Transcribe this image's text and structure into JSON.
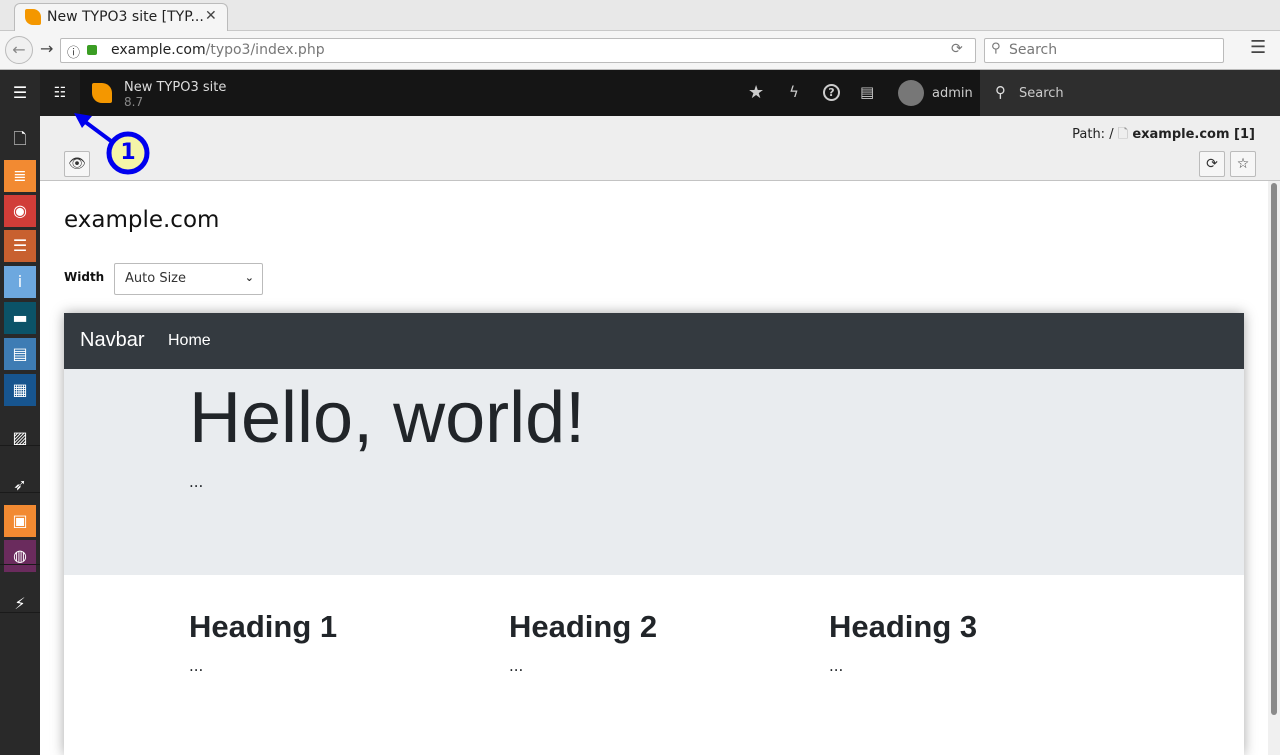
{
  "browser": {
    "tab_title": "New TYPO3 site [TYP...",
    "url_host": "example.com",
    "url_path": "/typo3/index.php",
    "search_placeholder": "Search"
  },
  "topbar": {
    "site_name": "New TYPO3 site",
    "version": "8.7",
    "user": "admin",
    "search_label": "Search"
  },
  "sidebar": {
    "modules": [
      {
        "name": "page",
        "color": "#292929",
        "glyph": "🗋"
      },
      {
        "name": "web-list",
        "color": "#f28a32",
        "glyph": "≣"
      },
      {
        "name": "view",
        "color": "#d13d38",
        "glyph": "◉"
      },
      {
        "name": "list",
        "color": "#c8602f",
        "glyph": "☰"
      },
      {
        "name": "info",
        "color": "#6da8df",
        "glyph": "i"
      },
      {
        "name": "template",
        "color": "#0b5368",
        "glyph": "▬"
      },
      {
        "name": "news",
        "color": "#3e7cb4",
        "glyph": "▤"
      },
      {
        "name": "layout",
        "color": "#17558f",
        "glyph": "▦"
      },
      {
        "name": "filelist",
        "color": "#292929",
        "glyph": "▨"
      },
      {
        "name": "rocket",
        "color": "#292929",
        "glyph": "➶"
      },
      {
        "name": "extension",
        "color": "#f28a32",
        "glyph": "▣"
      },
      {
        "name": "sites",
        "color": "#6a2b5d",
        "glyph": "◍"
      },
      {
        "name": "plugin",
        "color": "#292929",
        "glyph": "⚡"
      }
    ]
  },
  "docheader": {
    "path_label": "Path: /",
    "path_page": "example.com [1]"
  },
  "annotation": {
    "number": "1"
  },
  "main": {
    "title": "example.com",
    "width_label": "Width",
    "width_value": "Auto Size"
  },
  "preview": {
    "brand": "Navbar",
    "nav_home": "Home",
    "hero_title": "Hello, world!",
    "hero_text": "...",
    "columns": [
      {
        "heading": "Heading 1",
        "text": "..."
      },
      {
        "heading": "Heading 2",
        "text": "..."
      },
      {
        "heading": "Heading 3",
        "text": "..."
      }
    ]
  }
}
